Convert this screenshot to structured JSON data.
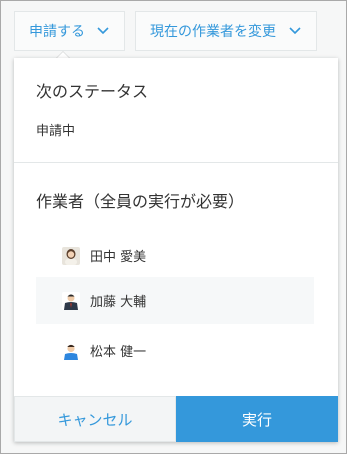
{
  "toolbar": {
    "apply_label": "申請する",
    "change_assignee_label": "現在の作業者を変更",
    "chevron_icon": "chevron-down-icon",
    "accent_color": "#3498db"
  },
  "popup": {
    "status_heading": "次のステータス",
    "status_value": "申請中",
    "assignee_heading": "作業者（全員の実行が必要）",
    "users": [
      {
        "name": "田中 愛美",
        "avatar": "avatar-woman"
      },
      {
        "name": "加藤 大輔",
        "avatar": "avatar-man-suit",
        "selected": true
      },
      {
        "name": "松本 健一",
        "avatar": "avatar-man-blue"
      }
    ],
    "cancel_label": "キャンセル",
    "execute_label": "実行",
    "primary_color": "#3498db"
  }
}
